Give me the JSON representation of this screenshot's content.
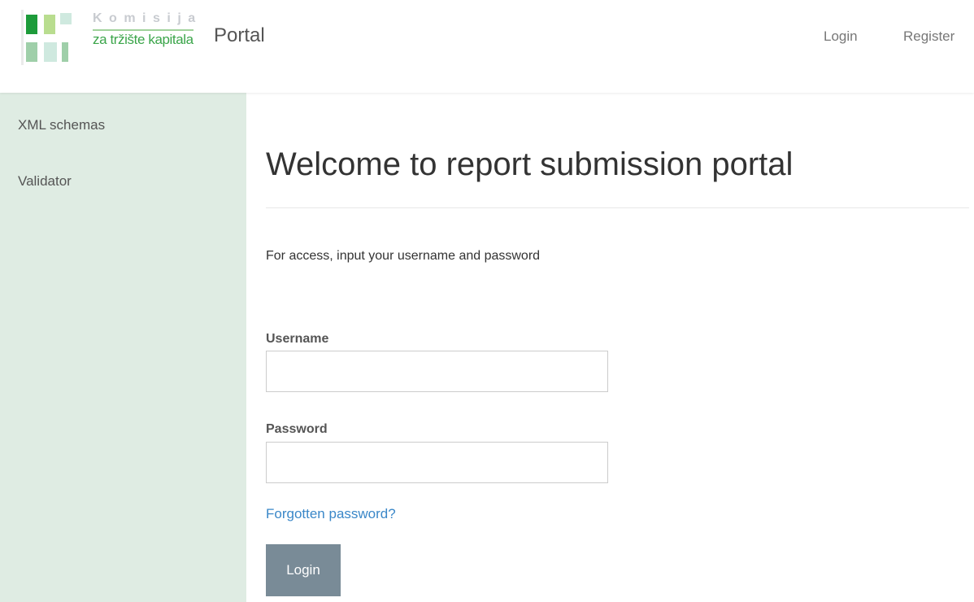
{
  "header": {
    "logo": {
      "top_text": "Komisija",
      "bottom_text": "za tržište kapitala",
      "colors": [
        "#1d9b3a",
        "#b9dd8f",
        "#9fcfa9",
        "#cfe9df"
      ]
    },
    "brand": "Portal",
    "nav": {
      "login": "Login",
      "register": "Register"
    }
  },
  "sidebar": {
    "items": [
      {
        "label": "XML schemas"
      },
      {
        "label": "Validator"
      }
    ]
  },
  "main": {
    "title": "Welcome to report submission portal",
    "intro": "For access, input your username and password",
    "form": {
      "username_label": "Username",
      "username_value": "",
      "password_label": "Password",
      "password_value": "",
      "forgot_link": "Forgotten password?",
      "submit_label": "Login"
    }
  },
  "colors": {
    "sidebar_bg": "#dfece3",
    "button_bg": "#798b97",
    "link": "#3a87c8"
  }
}
